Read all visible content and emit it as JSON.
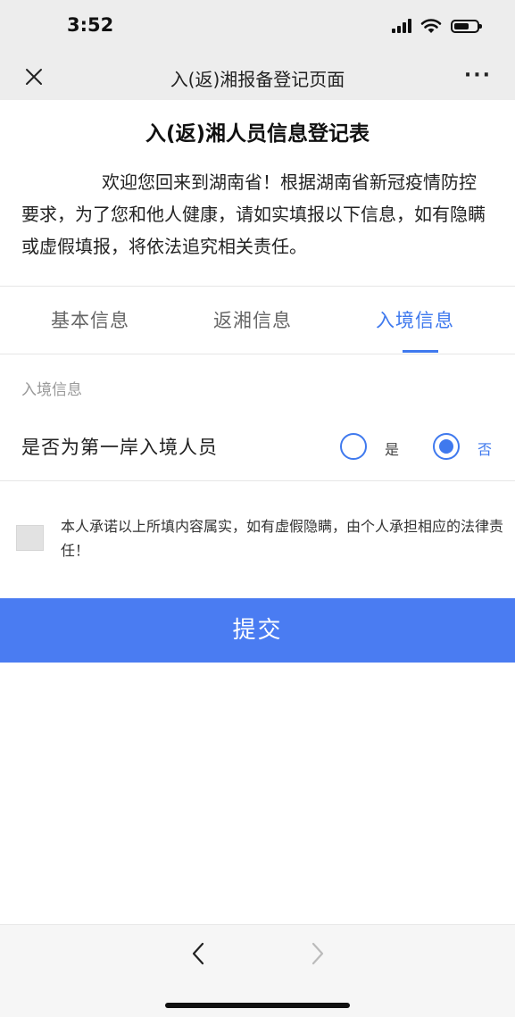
{
  "status_bar": {
    "time": "3:52"
  },
  "nav": {
    "title": "入(返)湘报备登记页面",
    "more": "···"
  },
  "form": {
    "title": "入(返)湘人员信息登记表",
    "intro": "欢迎您回来到湖南省！根据湖南省新冠疫情防控要求，为了您和他人健康，请如实填报以下信息，如有隐瞒或虚假填报，将依法追究相关责任。"
  },
  "tabs": [
    {
      "label": "基本信息",
      "active": false
    },
    {
      "label": "返湘信息",
      "active": false
    },
    {
      "label": "入境信息",
      "active": true
    }
  ],
  "section": {
    "label": "入境信息",
    "question": "是否为第一岸入境人员",
    "options": [
      {
        "label": "是",
        "selected": false
      },
      {
        "label": "否",
        "selected": true
      }
    ]
  },
  "pledge": {
    "checked": false,
    "text": "本人承诺以上所填内容属实，如有虚假隐瞒，由个人承担相应的法律责任！"
  },
  "submit_label": "提交",
  "colors": {
    "accent": "#3f79ee",
    "submit_bg": "#4a7cf2"
  },
  "icons": {
    "close": "close-icon",
    "more": "more-icon",
    "back": "chevron-left-icon",
    "forward": "chevron-right-icon",
    "signal": "signal-icon",
    "wifi": "wifi-icon",
    "battery": "battery-icon"
  }
}
